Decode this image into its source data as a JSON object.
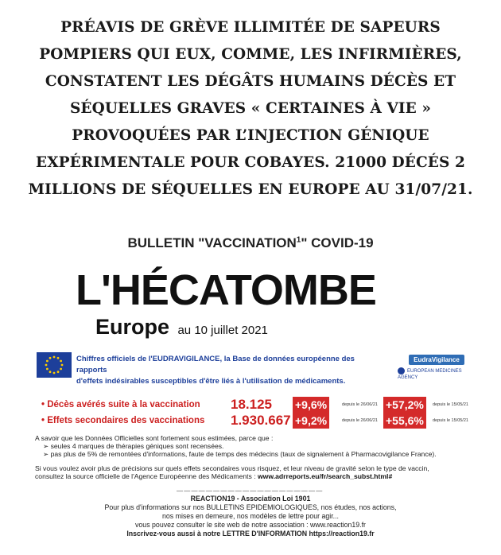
{
  "headline": [
    "PRÉAVIS DE GRÈVE ILLIMITÉE DE SAPEURS",
    "POMPIERS QUI EUX, COMME, LES INFIRMIÈRES,",
    "CONSTATENT LES DÉGÂTS HUMAINS DÉCÈS ET",
    "SÉQUELLES GRAVES « CERTAINES À VIE »",
    "PROVOQUÉES PAR L’INJECTION GÉNIQUE",
    "EXPÉRIMENTALE POUR COBAYES. 21000 DÉCÉS 2",
    "MILLIONS DE SÉQUELLES EN EUROPE AU 31/07/21."
  ],
  "bulletin": {
    "title_before": "BULLETIN \"VACCINATION",
    "title_sup": "1",
    "title_after": "\" COVID-19",
    "main_title": "L'HÉCATOMBE",
    "region": "Europe",
    "date": "au 10 juillet 2021"
  },
  "source": {
    "line1": "Chiffres officiels de l'EUDRAVIGILANCE, la Base de données européenne des rapports",
    "line2": "d'effets indésirables susceptibles d'être liés à l'utilisation de médicaments.",
    "logo_eudra": "EudraVigilance",
    "logo_ema": "EUROPEAN MEDICINES AGENCY",
    "colors": {
      "eu_blue": "#1d3f9a",
      "eu_star": "#ffcc00",
      "alert_red": "#d42a2a"
    }
  },
  "stats": [
    {
      "label": "• Décès avérés suite à la vaccination",
      "value": "18.125",
      "pct1": "+9,6%",
      "since1": "depuis le 26/06/21",
      "pct2": "+57,2%",
      "since2": "depuis le 15/05/21"
    },
    {
      "label": "• Effets secondaires des vaccinations",
      "value": "1.930.667",
      "pct1": "+9,2%",
      "since1": "depuis le 26/06/21",
      "pct2": "+55,6%",
      "since2": "depuis le 15/05/21"
    }
  ],
  "info": {
    "intro": "A savoir que les Données Officielles sont fortement sous estimées, parce que :",
    "bullet1": "➢  seules 4 marques de thérapies géniques sont recensées.",
    "bullet2": "➢  pas plus de 5% de remontées d'informations, faute de temps des médecins (taux de signalement à Pharmacovigilance France).",
    "more1": "Si vous voulez avoir plus de précisions sur quels effets secondaires vous risquez, et leur niveau de gravité selon le type de vaccin,",
    "more2_before": "consultez la source officielle de l'Agence Européenne des Médicaments : ",
    "more2_link": "www.adrreports.eu/fr/search_subst.html#"
  },
  "footer": {
    "divider": "— — — — — — — — — — — — — — — — — — — —",
    "org": "REACTION19 - Association Loi 1901",
    "line1": "Pour plus d'informations sur nos BULLETINS EPIDEMIOLOGIQUES, nos études, nos actions,",
    "line2": "nos mises en demeure, nos modèles de lettre pour agir...",
    "line3": "vous pouvez consulter le site web de notre association : www.reaction19.fr",
    "line4": "Inscrivez-vous aussi à notre LETTRE D'INFORMATION https://reaction19.fr"
  }
}
